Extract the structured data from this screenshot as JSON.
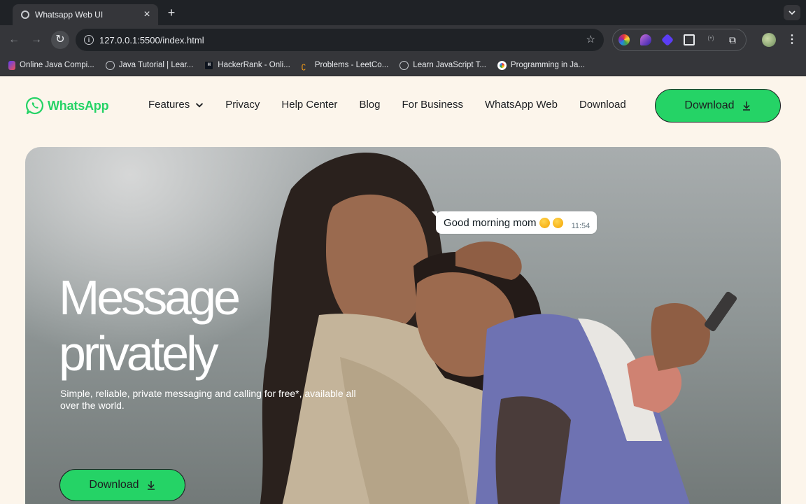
{
  "browser": {
    "tab_title": "Whatsapp Web UI",
    "url": "127.0.0.1:5500/index.html",
    "bookmarks": [
      {
        "label": "Online Java Compi..."
      },
      {
        "label": "Java Tutorial | Lear..."
      },
      {
        "label": "HackerRank - Onli..."
      },
      {
        "label": "Problems - LeetCo..."
      },
      {
        "label": "Learn JavaScript T..."
      },
      {
        "label": "Programming in Ja..."
      }
    ]
  },
  "header": {
    "logo_text": "WhatsApp",
    "nav": [
      "Features",
      "Privacy",
      "Help Center",
      "Blog",
      "For Business",
      "WhatsApp Web",
      "Download"
    ],
    "download_label": "Download"
  },
  "hero": {
    "title_line1": "Message",
    "title_line2": "privately",
    "subtitle": "Simple, reliable, private messaging and calling for free*, available all over the world.",
    "download_label": "Download",
    "bubble": {
      "text": "Good morning mom",
      "time": "11:54"
    }
  },
  "colors": {
    "brand_green": "#25d366",
    "page_bg": "#fcf5eb",
    "text_dark": "#1c1e21"
  }
}
